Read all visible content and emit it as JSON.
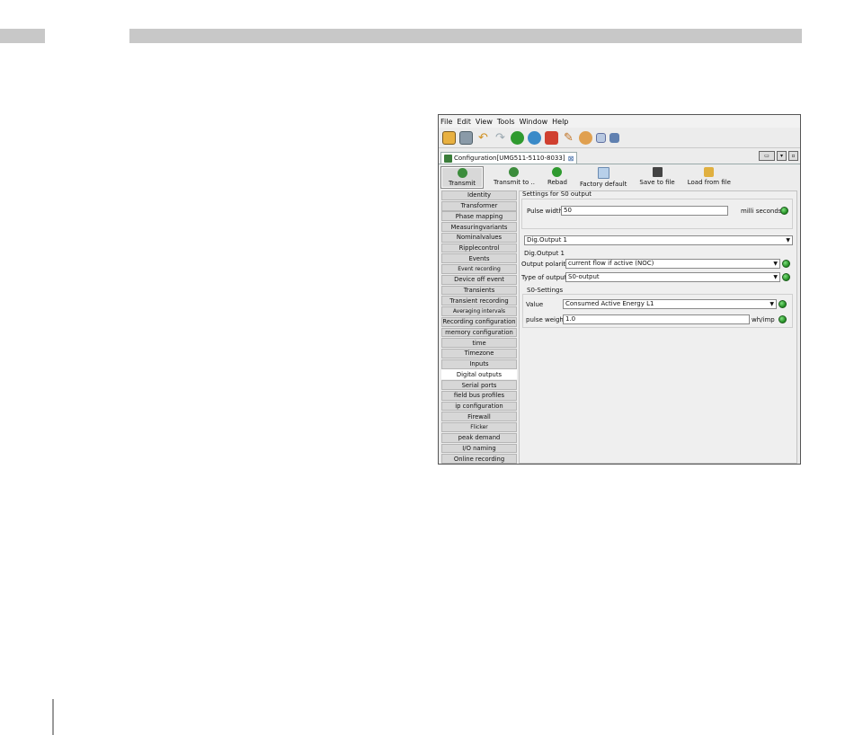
{
  "window": {
    "menu": [
      "File",
      "Edit",
      "View",
      "Tools",
      "Window",
      "Help"
    ],
    "tab_title": "Configuration[UMG511-5110-8033]",
    "actions": [
      {
        "label": "Transmit",
        "color": "#3c8c3c"
      },
      {
        "label": "Transmit to ..",
        "color": "#3c8c3c"
      },
      {
        "label": "Rebad",
        "color": "#2f9a2f"
      },
      {
        "label": "Factory default",
        "color": "#6aa0d8"
      },
      {
        "label": "Save to file",
        "color": "#444444"
      },
      {
        "label": "Load from file",
        "color": "#e0b040"
      }
    ],
    "nav": [
      "Identity",
      "Transformer",
      "Phase mapping",
      "Measuringvariants",
      "Nominalvalues",
      "Ripplecontrol",
      "Events",
      "Event recording",
      "Device off event",
      "Transients",
      "Transient recording",
      "Averaging intervals",
      "Recording configuration",
      "memory configuration",
      "time",
      "Timezone",
      "Inputs",
      "Digital outputs",
      "Serial ports",
      "field bus profiles",
      "ip configuration",
      "Firewall",
      "Flicker",
      "peak demand",
      "I/O naming",
      "Online recording"
    ],
    "nav_selected": "Digital outputs",
    "panel": {
      "header": "Settings for S0 output",
      "pulse_width_label": "Pulse width",
      "pulse_width_value": "50",
      "pulse_width_unit": "milli seconds",
      "output_select": "Dig.Output 1",
      "output_heading": "Dig.Output 1",
      "polarity_label": "Output polarity",
      "polarity_value": "current flow if active (NOC)",
      "type_label": "Type of output",
      "type_value": "S0-output",
      "s0_heading": "S0-Settings",
      "value_label": "Value",
      "value_value": "Consumed Active Energy L1",
      "pulse_weight_label": "pulse weight",
      "pulse_weight_value": "1.0",
      "pulse_weight_unit": "wh/imp"
    }
  },
  "colors": {
    "header_bar": "#c8c8c8",
    "status_led": "#2e9e2e"
  }
}
